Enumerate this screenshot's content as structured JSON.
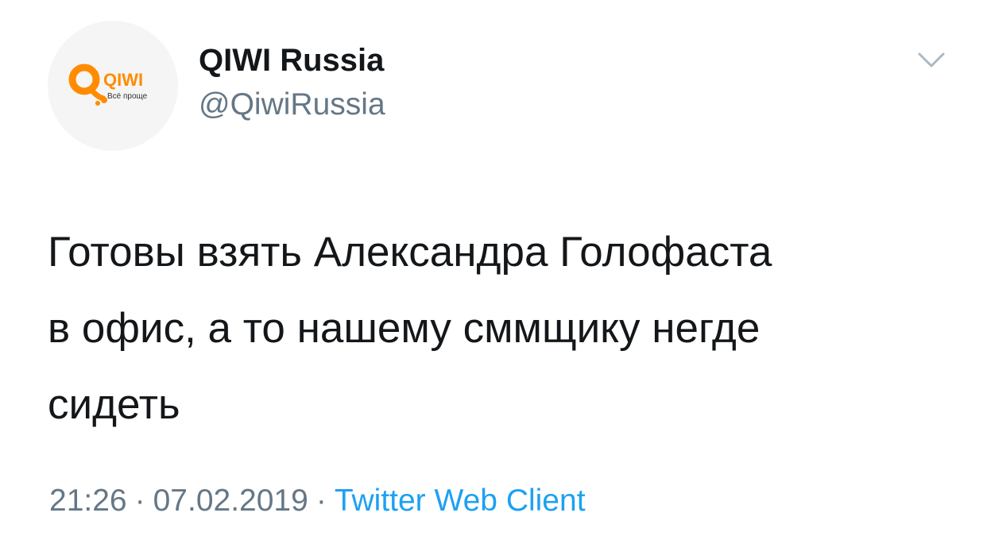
{
  "author": {
    "display_name": "QIWI Russia",
    "handle": "@QiwiRussia",
    "avatar": {
      "icon": "qiwi-logo-icon",
      "logo_text": "QIWI",
      "tagline": "Всё проще",
      "brand_color": "#ff8c00"
    }
  },
  "menu": {
    "icon": "chevron-down-icon"
  },
  "tweet": {
    "text_lines": [
      "Готовы взять Александра Голофаста",
      "в офис, а то нашему сммщику негде",
      "сидеть"
    ]
  },
  "meta": {
    "time": "21:26",
    "separator": "·",
    "date": "07.02.2019",
    "source": "Twitter Web Client"
  },
  "colors": {
    "text": "#14171a",
    "secondary": "#657786",
    "link": "#1da1f2"
  }
}
